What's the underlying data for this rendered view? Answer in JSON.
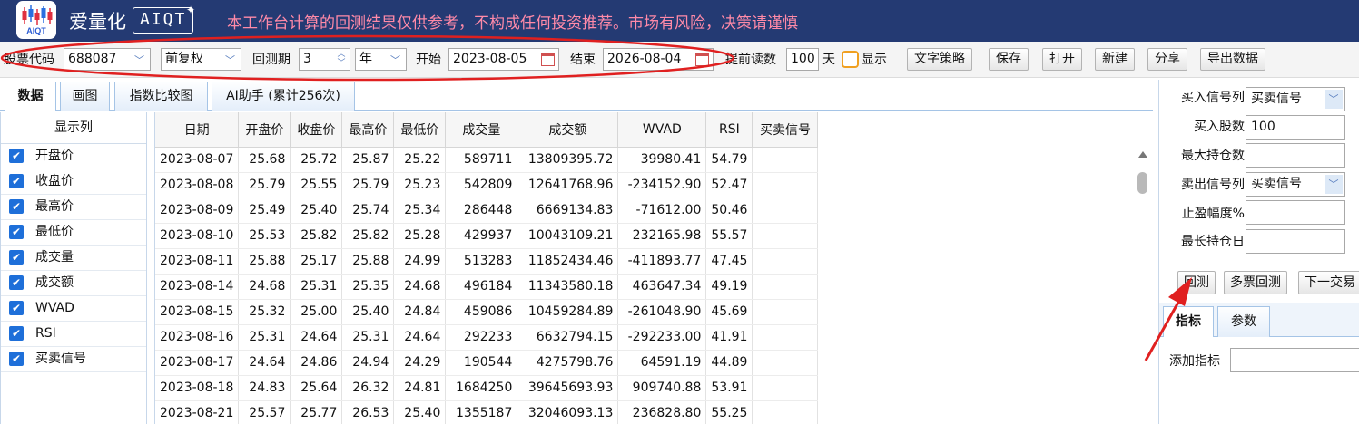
{
  "header": {
    "brand_name": "爱量化",
    "brand_en": "AIQT",
    "logo_sub": "AIQT",
    "disclaimer": "本工作台计算的回测结果仅供参考，不构成任何投资推荐。市场有风险，决策请谨慎",
    "bg_color": "#243a73",
    "disclaimer_color": "#ff8aa8"
  },
  "toolbar": {
    "stock_code_label": "股票代码",
    "stock_code_value": "688087",
    "adjust_value": "前复权",
    "period_label": "回测期",
    "period_value": "3",
    "period_unit": "年",
    "start_label": "开始",
    "start_value": "2023-08-05",
    "end_label": "结束",
    "end_value": "2026-08-04",
    "preread_label": "提前读数",
    "preread_value": "100",
    "preread_unit": "天",
    "show_label": "显示",
    "buttons": {
      "strategy": "文字策略",
      "save": "保存",
      "open": "打开",
      "new": "新建",
      "share": "分享",
      "export": "导出数据"
    }
  },
  "tabs": [
    "数据",
    "画图",
    "指数比较图",
    "AI助手 (累计256次)"
  ],
  "columns_panel": {
    "title": "显示列",
    "items": [
      "开盘价",
      "收盘价",
      "最高价",
      "最低价",
      "成交量",
      "成交额",
      "WVAD",
      "RSI",
      "买卖信号"
    ]
  },
  "table": {
    "headers": [
      "日期",
      "开盘价",
      "收盘价",
      "最高价",
      "最低价",
      "成交量",
      "成交额",
      "WVAD",
      "RSI",
      "买卖信号"
    ],
    "rows": [
      [
        "2023-08-07",
        "25.68",
        "25.72",
        "25.87",
        "25.22",
        "589711",
        "13809395.72",
        "39980.41",
        "54.79",
        ""
      ],
      [
        "2023-08-08",
        "25.79",
        "25.55",
        "25.79",
        "25.23",
        "542809",
        "12641768.96",
        "-234152.90",
        "52.47",
        ""
      ],
      [
        "2023-08-09",
        "25.49",
        "25.40",
        "25.74",
        "25.34",
        "286448",
        "6669134.83",
        "-71612.00",
        "50.46",
        ""
      ],
      [
        "2023-08-10",
        "25.53",
        "25.82",
        "25.82",
        "25.28",
        "429937",
        "10043109.21",
        "232165.98",
        "55.57",
        ""
      ],
      [
        "2023-08-11",
        "25.88",
        "25.17",
        "25.88",
        "24.99",
        "513283",
        "11852434.46",
        "-411893.77",
        "47.45",
        ""
      ],
      [
        "2023-08-14",
        "24.68",
        "25.31",
        "25.35",
        "24.68",
        "496184",
        "11343580.18",
        "463647.34",
        "49.19",
        ""
      ],
      [
        "2023-08-15",
        "25.32",
        "25.00",
        "25.40",
        "24.84",
        "459086",
        "10459284.89",
        "-261048.90",
        "45.69",
        ""
      ],
      [
        "2023-08-16",
        "25.31",
        "24.64",
        "25.31",
        "24.64",
        "292233",
        "6632794.15",
        "-292233.00",
        "41.91",
        ""
      ],
      [
        "2023-08-17",
        "24.64",
        "24.86",
        "24.94",
        "24.29",
        "190544",
        "4275798.76",
        "64591.19",
        "44.89",
        ""
      ],
      [
        "2023-08-18",
        "24.83",
        "25.64",
        "26.32",
        "24.81",
        "1684250",
        "39645693.93",
        "909740.88",
        "53.91",
        ""
      ],
      [
        "2023-08-21",
        "25.57",
        "25.77",
        "26.53",
        "25.40",
        "1355187",
        "32046093.13",
        "236828.80",
        "55.25",
        ""
      ]
    ]
  },
  "right_panel": {
    "buy_signal_label": "买入信号列",
    "buy_signal_value": "买卖信号",
    "buy_shares_label": "买入股数",
    "buy_shares_value": "100",
    "max_pos_label": "最大持仓数",
    "sell_signal_label": "卖出信号列",
    "sell_signal_value": "买卖信号",
    "take_profit_label": "止盈幅度%",
    "max_hold_label": "最长持仓日",
    "btn_backtest": "回测",
    "btn_multi": "多票回测",
    "btn_next": "下一交易",
    "sub_tabs": [
      "指标",
      "参数"
    ],
    "add_indicator_label": "添加指标"
  },
  "annotation_color": "#e02020"
}
